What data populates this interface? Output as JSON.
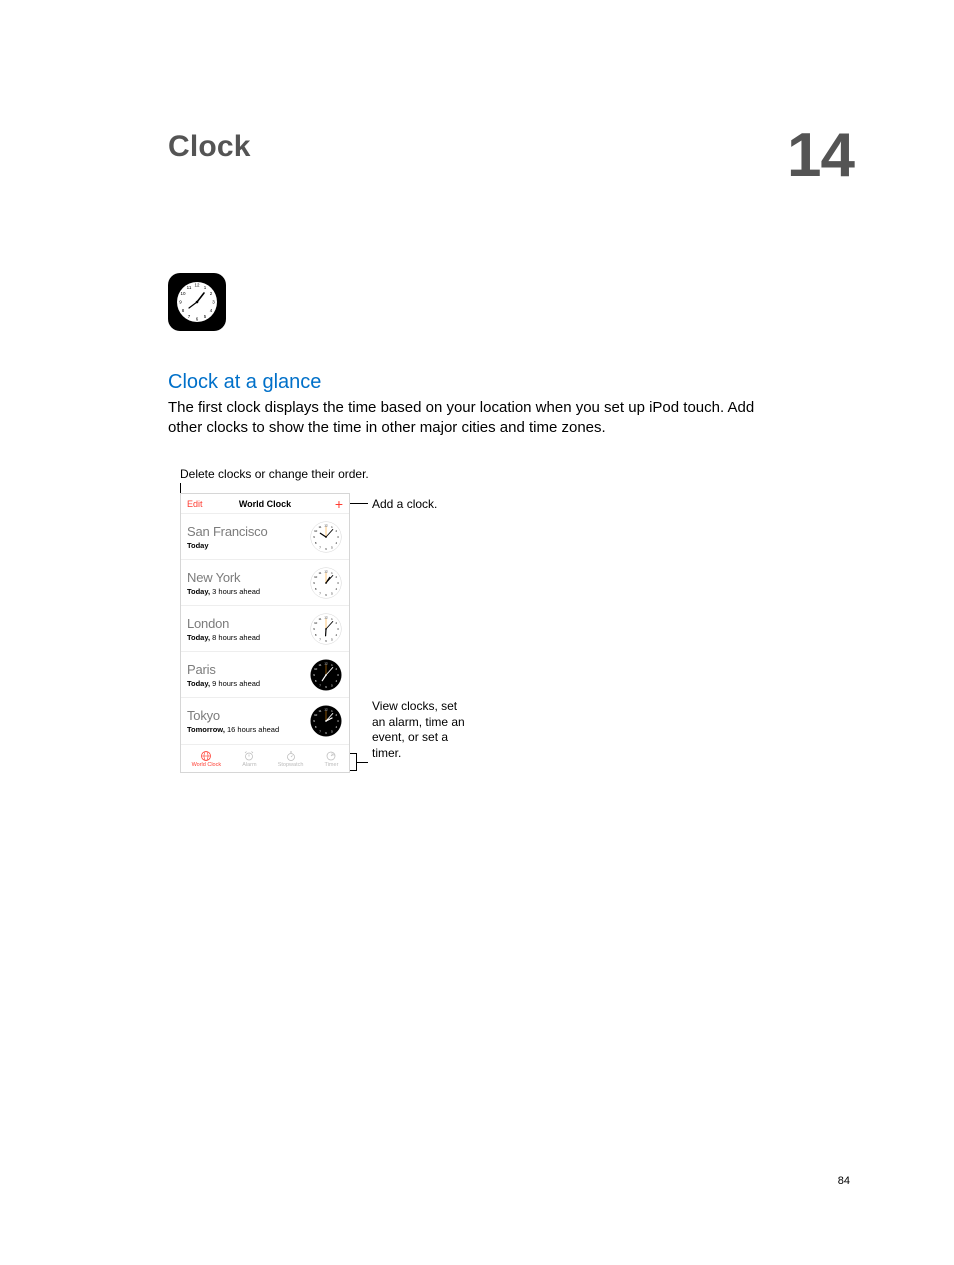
{
  "chapter": {
    "title": "Clock",
    "number": "14"
  },
  "section": {
    "title": "Clock at a glance",
    "body": "The first clock displays the time based on your location when you set up iPod touch. Add other clocks to show the time in other major cities and time zones."
  },
  "callouts": {
    "top": "Delete clocks or change their order.",
    "add": "Add a clock.",
    "bottom": "View clocks, set an alarm, time an event, or set a timer."
  },
  "phone": {
    "nav": {
      "edit": "Edit",
      "title": "World Clock",
      "plus": "+"
    },
    "rows": [
      {
        "city": "San Francisco",
        "day": "Today",
        "offset": "",
        "dark": false,
        "hour": 10,
        "minute": 7
      },
      {
        "city": "New York",
        "day": "Today,",
        "offset": " 3 hours ahead",
        "dark": false,
        "hour": 1,
        "minute": 7
      },
      {
        "city": "London",
        "day": "Today,",
        "offset": " 8 hours ahead",
        "dark": false,
        "hour": 6,
        "minute": 7
      },
      {
        "city": "Paris",
        "day": "Today,",
        "offset": " 9 hours ahead",
        "dark": true,
        "hour": 7,
        "minute": 7
      },
      {
        "city": "Tokyo",
        "day": "Tomorrow,",
        "offset": " 16 hours ahead",
        "dark": true,
        "hour": 2,
        "minute": 7
      }
    ],
    "tabs": [
      {
        "label": "World Clock",
        "active": true
      },
      {
        "label": "Alarm",
        "active": false
      },
      {
        "label": "Stopwatch",
        "active": false
      },
      {
        "label": "Timer",
        "active": false
      }
    ]
  },
  "pageNumber": "84"
}
